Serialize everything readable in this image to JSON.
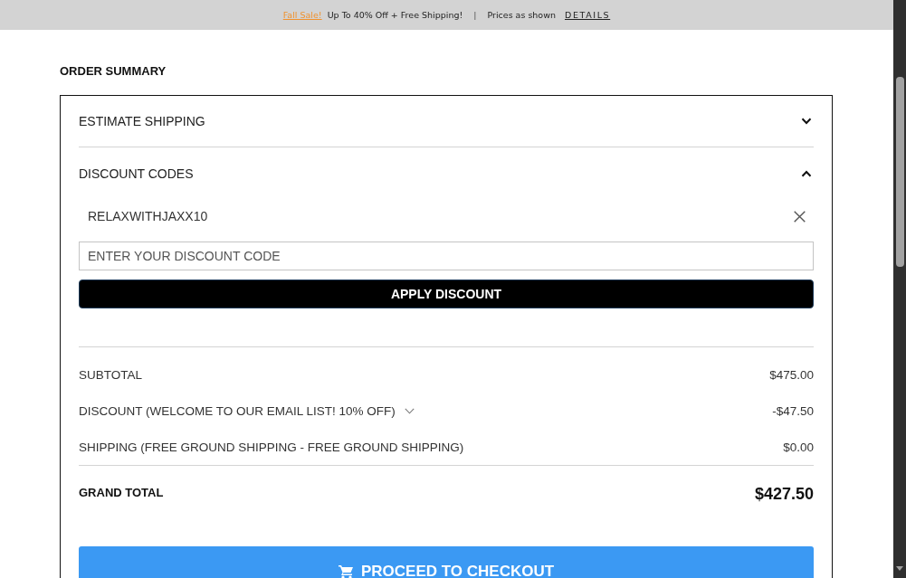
{
  "promo_banner": {
    "sale_link": "Fall Sale!",
    "message": "Up To 40% Off + Free Shipping!",
    "separator": "|",
    "note": "Prices as shown",
    "details_link": "DETAILS"
  },
  "order_summary": {
    "title": "ORDER SUMMARY",
    "sections": [
      {
        "label": "ESTIMATE SHIPPING",
        "expanded": false
      },
      {
        "label": "DISCOUNT CODES",
        "expanded": true,
        "applied_codes": [
          "RELAXWITHJAXX10"
        ],
        "input": {
          "placeholder": "ENTER YOUR DISCOUNT CODE"
        },
        "button": "APPLY DISCOUNT"
      }
    ],
    "totals": [
      {
        "kind": "plain",
        "label": "SUBTOTAL",
        "value": "$475.00"
      },
      {
        "kind": "expandable",
        "label": "DISCOUNT (WELCOME TO OUR EMAIL LIST! 10% OFF)",
        "value": "-$47.50"
      },
      {
        "kind": "plain",
        "label": "SHIPPING (FREE GROUND SHIPPING - FREE GROUND SHIPPING)",
        "value": "$0.00"
      }
    ],
    "grand_total": {
      "label": "GRAND TOTAL",
      "value": "$427.50"
    },
    "checkout_button": "PROCEED TO CHECKOUT"
  }
}
